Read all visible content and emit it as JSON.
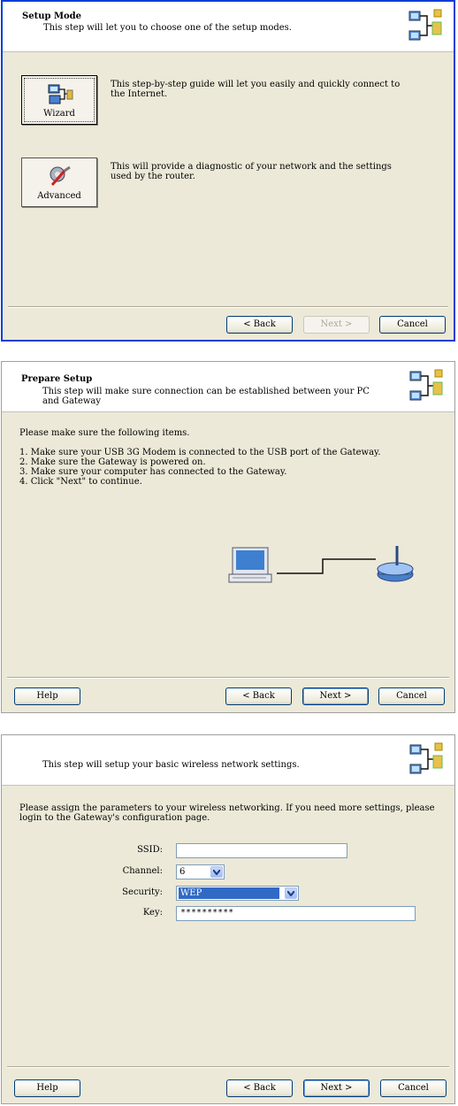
{
  "setup_mode": {
    "title": "Setup Mode",
    "subtitle": "This step will let you to choose one of the setup modes.",
    "wizard_label": "Wizard",
    "wizard_desc": "This step-by-step guide will let you easily and quickly connect to the Internet.",
    "advanced_label": "Advanced",
    "advanced_desc": "This will provide a diagnostic of your network and the settings used by the router.",
    "back_label": "< Back",
    "next_label": "Next >",
    "cancel_label": "Cancel"
  },
  "prepare_setup": {
    "title": "Prepare Setup",
    "subtitle": "This step will make sure connection can be established between your PC and Gateway",
    "intro": "Please make sure the following items.",
    "items": [
      "1. Make sure your USB 3G Modem is connected to the USB port of the Gateway.",
      "2. Make sure the Gateway is powered on.",
      "3. Make sure your computer has connected to the Gateway.",
      "4. Click \"Next\" to continue."
    ],
    "help_label": "Help",
    "back_label": "< Back",
    "next_label": "Next >",
    "cancel_label": "Cancel"
  },
  "wireless_setup": {
    "subtitle": "This step will setup your basic wireless network settings.",
    "intro": "Please assign the parameters to your wireless networking. If you need more settings, please login to the Gateway's configuration page.",
    "ssid_label": "SSID:",
    "ssid_value": "",
    "channel_label": "Channel:",
    "channel_value": "6",
    "security_label": "Security:",
    "security_value": "WEP",
    "key_label": "Key:",
    "key_value": "**********",
    "help_label": "Help",
    "back_label": "< Back",
    "next_label": "Next >",
    "cancel_label": "Cancel"
  }
}
